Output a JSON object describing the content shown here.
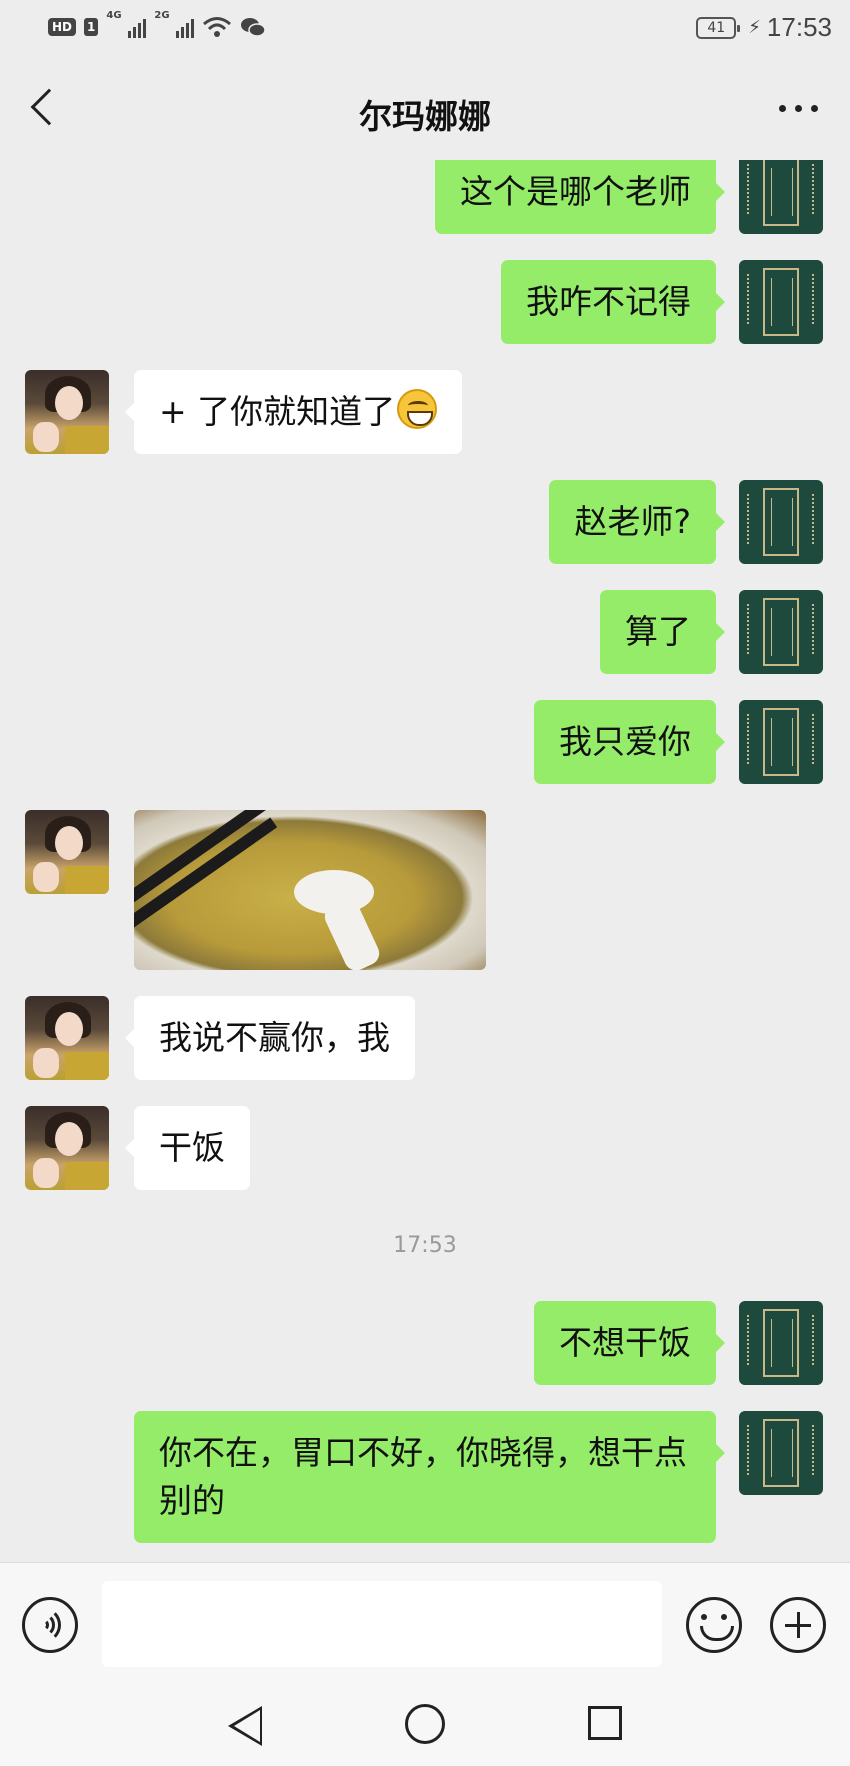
{
  "status_bar": {
    "hd_label": "HD",
    "sim_label": "1",
    "network_1": "4G",
    "network_2": "2G",
    "battery": "41",
    "time": "17:53"
  },
  "header": {
    "title": "尔玛娜娜",
    "back_icon": "chevron-left-icon",
    "more_icon": "more-dots-icon"
  },
  "messages": [
    {
      "from": "me",
      "text": "这个是哪个老师"
    },
    {
      "from": "me",
      "text": "我咋不记得"
    },
    {
      "from": "her",
      "text": "+ 了你就知道了",
      "emoji": "grinning-face-emoji"
    },
    {
      "from": "me",
      "text": "赵老师?"
    },
    {
      "from": "me",
      "text": "算了"
    },
    {
      "from": "me",
      "text": "我只爱你"
    },
    {
      "from": "her",
      "type": "image",
      "image": "noodle-soup-bowl-photo"
    },
    {
      "from": "her",
      "text": "我说不赢你，我"
    },
    {
      "from": "her",
      "text": "干饭"
    },
    {
      "type": "time",
      "text": "17:53"
    },
    {
      "from": "me",
      "text": "不想干饭"
    },
    {
      "from": "me",
      "text": "你不在，胃口不好，你晓得，想干点别的"
    }
  ],
  "input_bar": {
    "voice_icon": "voice-icon",
    "input_value": "",
    "emoji_icon": "emoji-icon",
    "plus_icon": "plus-icon"
  },
  "system_nav": {
    "back": "nav-back-icon",
    "home": "nav-home-icon",
    "recent": "nav-recent-icon"
  },
  "colors": {
    "background": "#ededed",
    "my_bubble": "#95ec69",
    "her_bubble": "#ffffff"
  }
}
